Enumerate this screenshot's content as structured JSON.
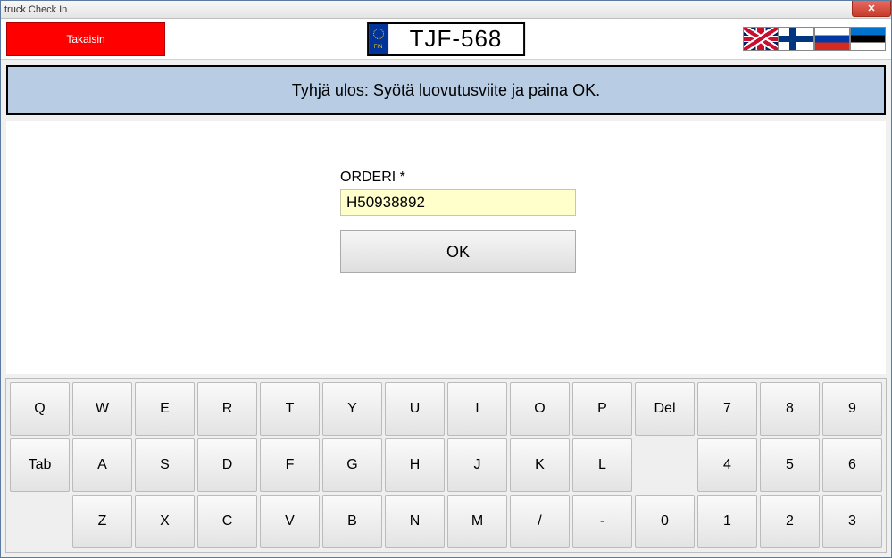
{
  "window": {
    "title": "truck Check In"
  },
  "header": {
    "back_label": "Takaisin",
    "plate_country": "FIN",
    "plate_text": "TJF-568",
    "flags": [
      "uk",
      "fi",
      "ru",
      "ee"
    ]
  },
  "instruction": "Tyhjä ulos: Syötä luovutusviite ja paina OK.",
  "form": {
    "label": "ORDERI *",
    "value": "H50938892",
    "ok_label": "OK"
  },
  "keyboard": {
    "row1": [
      "Q",
      "W",
      "E",
      "R",
      "T",
      "Y",
      "U",
      "I",
      "O",
      "P",
      "Del",
      "7",
      "8",
      "9"
    ],
    "row2": [
      "Tab",
      "A",
      "S",
      "D",
      "F",
      "G",
      "H",
      "J",
      "K",
      "L",
      "",
      "4",
      "5",
      "6"
    ],
    "row3": [
      "",
      "Z",
      "X",
      "C",
      "V",
      "B",
      "N",
      "M",
      "/",
      "-",
      "0",
      "1",
      "2",
      "3"
    ]
  }
}
